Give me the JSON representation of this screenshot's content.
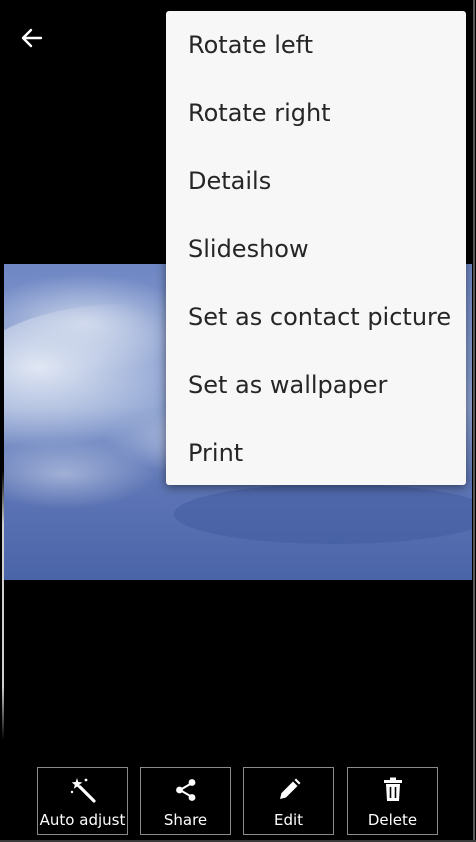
{
  "menu": {
    "items": [
      {
        "label": "Rotate left"
      },
      {
        "label": "Rotate right"
      },
      {
        "label": "Details"
      },
      {
        "label": "Slideshow"
      },
      {
        "label": "Set as contact picture"
      },
      {
        "label": "Set as wallpaper"
      },
      {
        "label": "Print"
      }
    ]
  },
  "toolbar": {
    "buttons": [
      {
        "label": "Auto adjust",
        "icon": "magic-wand-icon"
      },
      {
        "label": "Share",
        "icon": "share-icon"
      },
      {
        "label": "Edit",
        "icon": "pencil-icon"
      },
      {
        "label": "Delete",
        "icon": "trash-icon"
      }
    ]
  },
  "colors": {
    "background": "#000000",
    "menu_background": "#f7f7f7",
    "menu_text": "#262626",
    "sky_blue": "#5a73b0"
  },
  "icons": {
    "back": "arrow-left-icon"
  }
}
